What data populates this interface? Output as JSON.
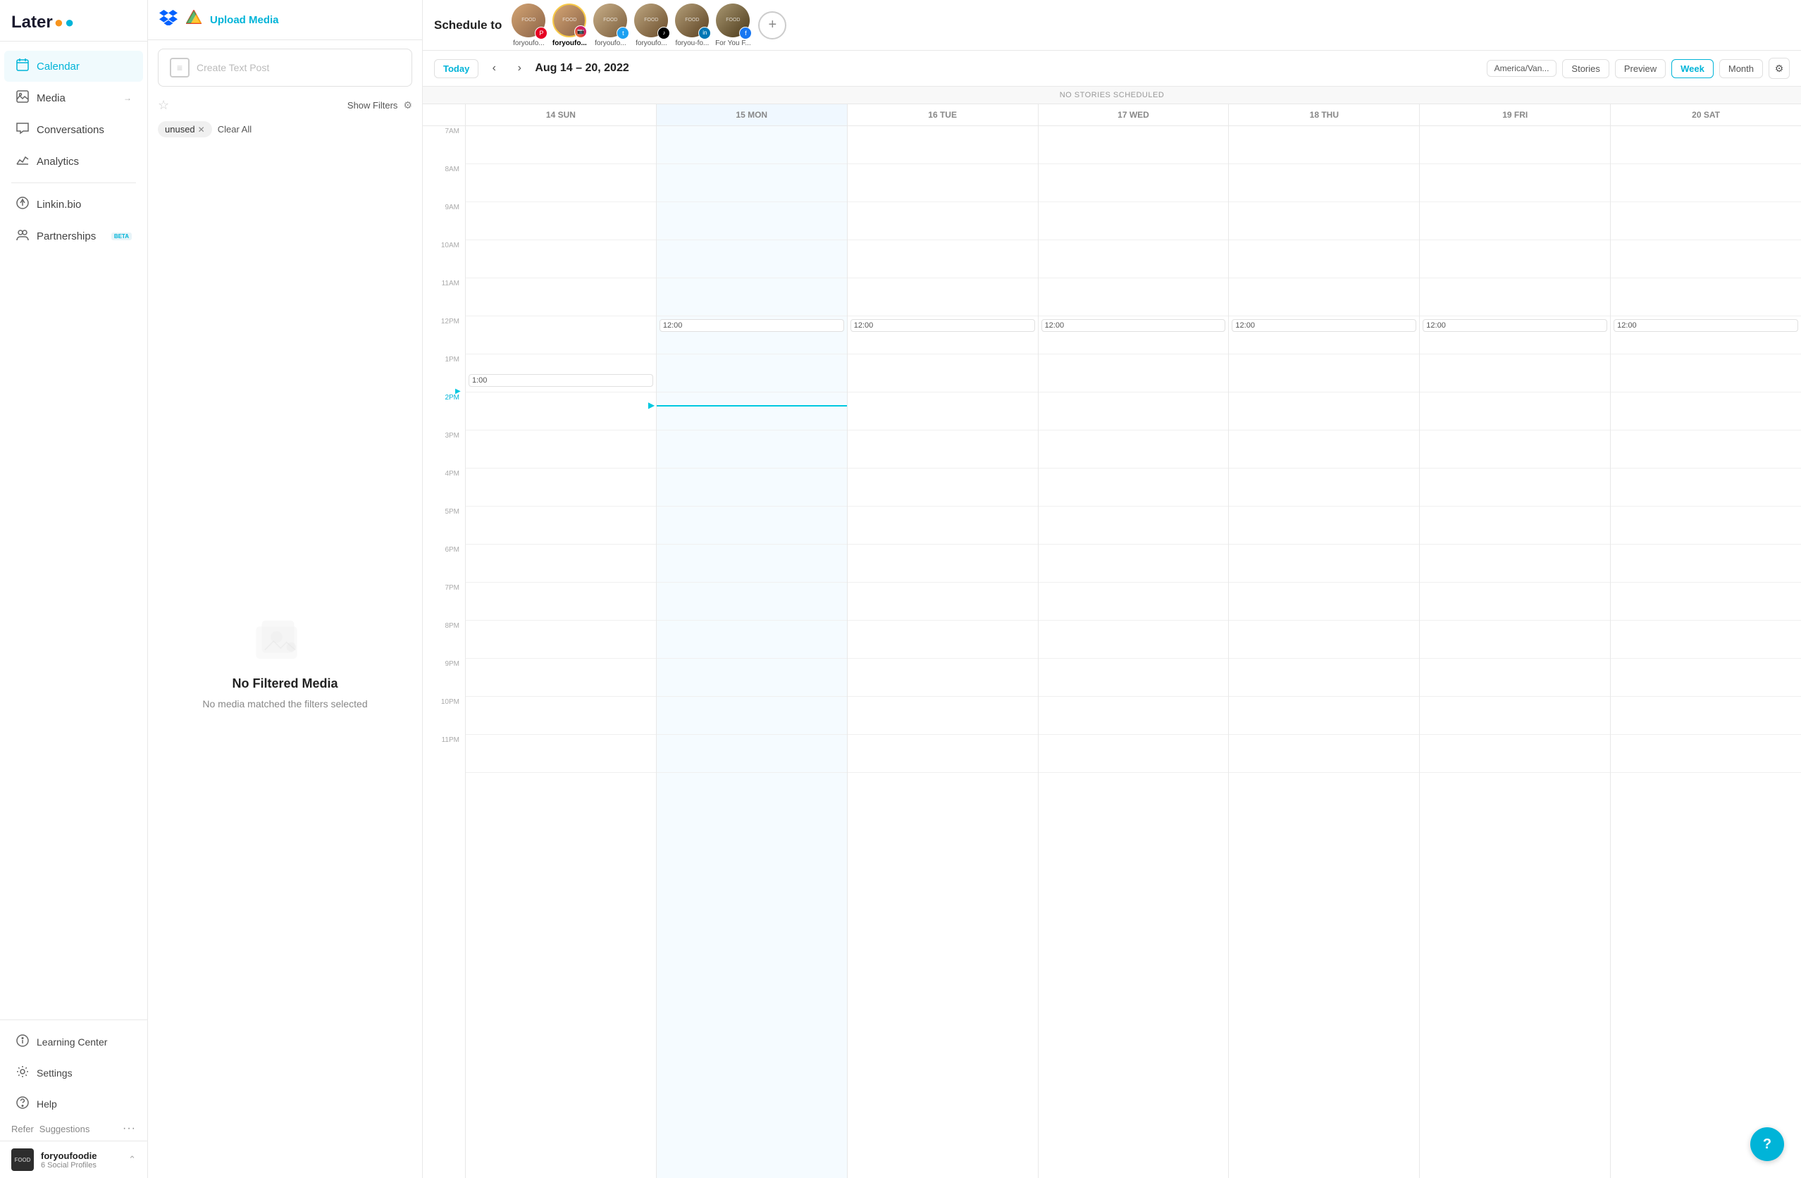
{
  "logo": {
    "text": "Later",
    "dot1": "●",
    "dot2": "●"
  },
  "sidebar": {
    "nav_items": [
      {
        "id": "calendar",
        "label": "Calendar",
        "active": true,
        "icon": "calendar-icon"
      },
      {
        "id": "media",
        "label": "Media",
        "active": false,
        "icon": "media-icon",
        "has_arrow": true
      },
      {
        "id": "conversations",
        "label": "Conversations",
        "active": false,
        "icon": "conversations-icon"
      },
      {
        "id": "analytics",
        "label": "Analytics",
        "active": false,
        "icon": "analytics-icon"
      }
    ],
    "linkin_bio": "Linkin.bio",
    "partnerships": "Partnerships",
    "partnerships_badge": "BETA",
    "bottom_items": [
      {
        "id": "learning-center",
        "label": "Learning Center",
        "icon": "learning-icon"
      },
      {
        "id": "settings",
        "label": "Settings",
        "icon": "settings-icon"
      },
      {
        "id": "help",
        "label": "Help",
        "icon": "help-icon"
      }
    ],
    "refer": "Refer",
    "suggestions": "Suggestions",
    "profile_name": "foryoufoodie",
    "profile_sub": "6 Social Profiles"
  },
  "media_panel": {
    "upload_label": "Upload Media",
    "create_text_post": "Create Text Post",
    "show_filters": "Show Filters",
    "filter_tags": [
      {
        "label": "unused"
      }
    ],
    "clear_all": "Clear All",
    "empty_title": "No Filtered Media",
    "empty_sub": "No media matched the filters selected"
  },
  "schedule_header": {
    "label": "Schedule to",
    "profiles": [
      {
        "id": "p1",
        "name": "foryoufo...",
        "platform": "pinterest",
        "selected": false,
        "color": "#e8d5c4"
      },
      {
        "id": "p2",
        "name": "foryoufo...",
        "platform": "instagram",
        "selected": true,
        "color": "#d4b896"
      },
      {
        "id": "p3",
        "name": "foryoufo...",
        "platform": "twitter",
        "selected": false,
        "color": "#c9b08a"
      },
      {
        "id": "p4",
        "name": "foryoufo...",
        "platform": "tiktok",
        "selected": false,
        "color": "#bfa882"
      },
      {
        "id": "p5",
        "name": "foryou-fo...",
        "platform": "linkedin",
        "selected": false,
        "color": "#b5a07a"
      },
      {
        "id": "p6",
        "name": "For You F...",
        "platform": "facebook",
        "selected": false,
        "color": "#aa9872"
      }
    ],
    "add_profile": "+"
  },
  "calendar_nav": {
    "today": "Today",
    "date_range": "Aug 14 – 20, 2022",
    "timezone": "America/Van...",
    "views": [
      "Stories",
      "Preview",
      "Week",
      "Month"
    ],
    "active_view": "Week"
  },
  "calendar": {
    "no_stories": "NO STORIES SCHEDULED",
    "days": [
      {
        "label": "14 SUN",
        "is_today": false
      },
      {
        "label": "15 MON",
        "is_today": true
      },
      {
        "label": "16 TUE",
        "is_today": false
      },
      {
        "label": "17 WED",
        "is_today": false
      },
      {
        "label": "18 THU",
        "is_today": false
      },
      {
        "label": "19 FRI",
        "is_today": false
      },
      {
        "label": "20 SAT",
        "is_today": false
      }
    ],
    "time_slots": [
      "7AM",
      "8AM",
      "9AM",
      "10AM",
      "11AM",
      "12PM",
      "1PM",
      "2PM",
      "3PM",
      "4PM",
      "5PM",
      "6PM",
      "7PM",
      "8PM",
      "9PM",
      "10PM",
      "11PM"
    ],
    "scheduled_times": {
      "12pm": [
        "12:00",
        "12:00",
        "12:00",
        "12:00",
        "12:00",
        "12:00"
      ],
      "1pm": "1:00"
    },
    "current_time_row": "2PM"
  },
  "help_btn": "?"
}
